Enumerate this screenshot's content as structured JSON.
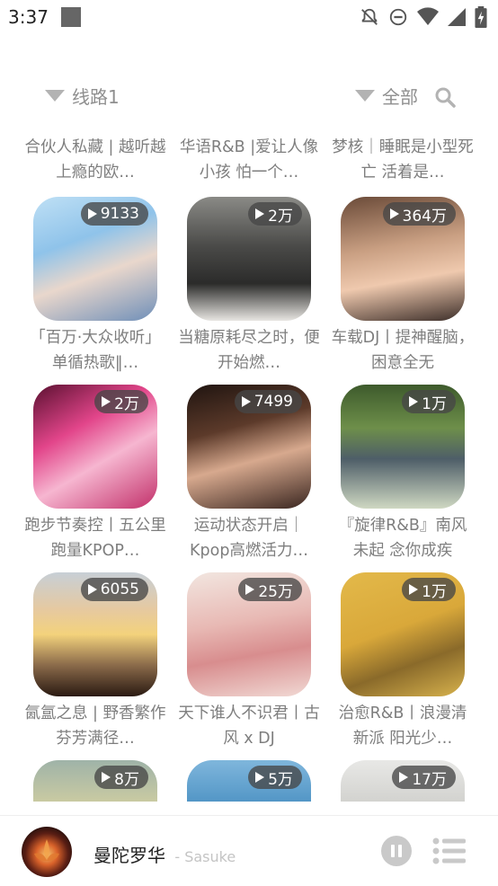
{
  "status_bar": {
    "time": "3:37",
    "icons": [
      "notifications-off-icon",
      "do-not-disturb-icon",
      "wifi-icon",
      "signal-icon",
      "battery-charging-icon"
    ]
  },
  "filter": {
    "route_label": "线路1",
    "category_label": "全部"
  },
  "playlists": [
    {
      "title": "合伙人私藏 | 越听越上瘾的欧…",
      "plays": null,
      "visible_image": false
    },
    {
      "title": "华语R&B |爱让人像小孩 怕一个…",
      "plays": null,
      "visible_image": false
    },
    {
      "title": "梦核｜睡眠是小型死亡 活着是…",
      "plays": null,
      "visible_image": false
    },
    {
      "title": "「百万·大众收听」单循热歌‖…",
      "plays": "9133"
    },
    {
      "title": "当糖原耗尽之时，便开始燃…",
      "plays": "2万"
    },
    {
      "title": "车载DJ丨提神醒脑，困意全无",
      "plays": "364万"
    },
    {
      "title": "跑步节奏控丨五公里跑量KPOP…",
      "plays": "2万"
    },
    {
      "title": "运动状态开启｜Kpop高燃活力…",
      "plays": "7499"
    },
    {
      "title": "『旋律R&B』南风未起 念你成疾",
      "plays": "1万"
    },
    {
      "title": "氤氲之息 | 野香繁作 芬芳满径…",
      "plays": "6055"
    },
    {
      "title": "天下谁人不识君丨古风 x DJ",
      "plays": "25万"
    },
    {
      "title": "治愈R&B丨浪漫清新派 阳光少…",
      "plays": "1万"
    },
    {
      "title": "",
      "plays": "8万"
    },
    {
      "title": "",
      "plays": "5万"
    },
    {
      "title": "",
      "plays": "17万"
    }
  ],
  "player": {
    "song": "曼陀罗华",
    "artist": "- Sasuke",
    "controls": [
      "pause-icon",
      "playlist-icon"
    ]
  },
  "colors": {
    "badge_bg": "#464646",
    "secondary_text": "#7e7e7e",
    "filter_text": "#8f8f8f"
  }
}
